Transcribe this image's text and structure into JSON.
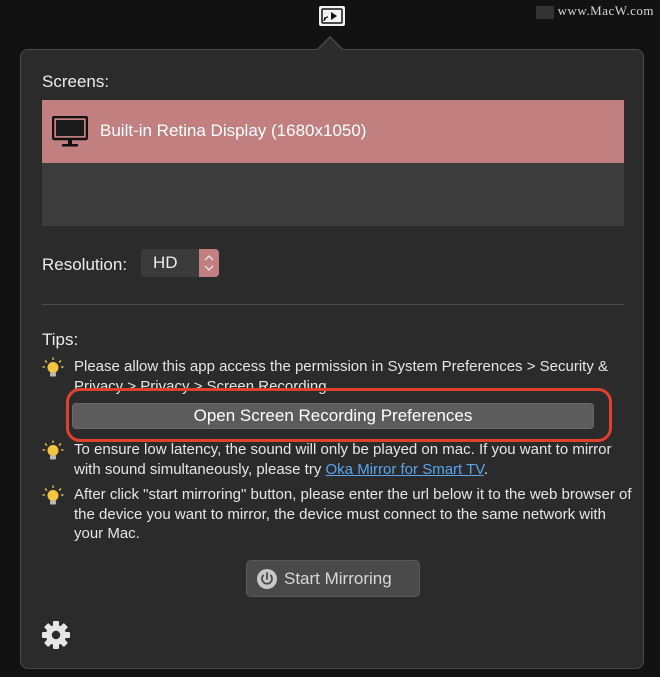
{
  "watermark": {
    "text": "www.MacW.com"
  },
  "menubar": {
    "icon": "screen-mirroring-icon"
  },
  "screens": {
    "label": "Screens:",
    "items": [
      {
        "name": "Built-in Retina Display (1680x1050)",
        "icon": "monitor-icon",
        "selected": true
      }
    ]
  },
  "resolution": {
    "label": "Resolution:",
    "value": "HD"
  },
  "tips": {
    "label": "Tips:",
    "items": [
      {
        "text": "Please allow this app access the permission in System Preferences > Security & Privacy > Privacy > Screen Recording"
      },
      {
        "text_before": "To ensure low latency, the sound will only be played on mac. If you want to mirror with sound simultaneously, please try ",
        "link": "Oka Mirror for Smart TV",
        "text_after": "."
      },
      {
        "text": "After click \"start mirroring\" button, please enter the url below it to the web browser of the device you want to mirror, the device must connect to the same network with your Mac."
      }
    ],
    "open_pref_button": "Open Screen Recording Preferences"
  },
  "start_button": {
    "label": "Start Mirroring",
    "icon": "power-icon"
  },
  "settings": {
    "icon": "gear-icon"
  },
  "colors": {
    "selection": "#c17f80",
    "highlight": "#e0402c",
    "link": "#58a6f0",
    "background": "#2b2b2b"
  }
}
